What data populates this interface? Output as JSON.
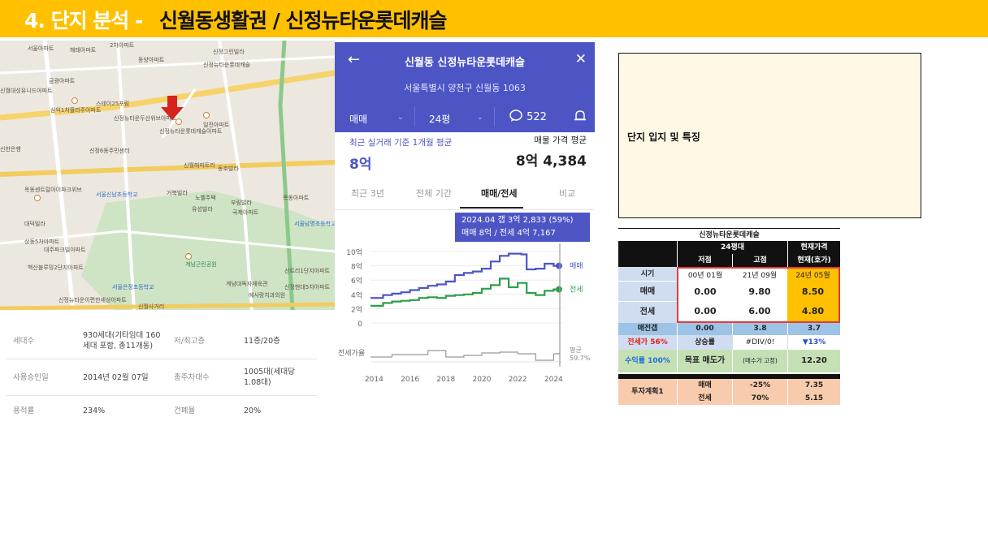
{
  "title": {
    "prefix": "4. 단지 분석 - ",
    "main": "신월동생활권 /  신정뉴타운롯데캐슬"
  },
  "map": {
    "labels": [
      "2차아파트",
      "서울아파트",
      "해태아파트",
      "동양아파트",
      "신정그린빌라",
      "신정뉴타운롯데캐슬",
      "금광아파트",
      "신월대성유니드아파트",
      "삼익1차플라주아파트",
      "스테이25포럼",
      "신정뉴타운두산위브아파트",
      "신정뉴타운롯데캐슬아파트",
      "일진아파트",
      "신정6동주민센터",
      "신월해피트리",
      "동호빌라",
      "신한은행",
      "목동센트럴아이파크위브",
      "서울신남초등학교",
      "거북빌라",
      "노벨주택",
      "유성빌라",
      "부림빌라",
      "국제아파트",
      "대덕빌라",
      "상동5차아파트",
      "대주파크빌아파트",
      "백산블루밍2단지아파트",
      "계남근린공원",
      "서울은정초등학교",
      "계남대독자체육관",
      "예사랑치과의원",
      "신정현대5차아파트",
      "선트리1단지아파트",
      "신월사거리",
      "신정뉴타운이편한세상아파트",
      "서울남명초등학교",
      "목동아파트"
    ]
  },
  "info_table": [
    {
      "k1": "세대수",
      "v1": "930세대(기타임대 160세대 포함, 총11개동)",
      "k2": "저/최고층",
      "v2": "11층/20층"
    },
    {
      "k1": "사용승인일",
      "v1": "2014년 02월 07일",
      "k2": "총주차대수",
      "v2": "1005대(세대당 1.08대)"
    },
    {
      "k1": "용적률",
      "v1": "234%",
      "k2": "건폐율",
      "v2": "20%"
    }
  ],
  "phone": {
    "back_icon": "←",
    "title": "신월동 신정뉴타운롯데캐슬",
    "close_icon": "✕",
    "address": "서울특별시 양천구 신월동 1063",
    "filter_type": "매매",
    "filter_size": "24평",
    "comment_count": "522",
    "basis_label": "최근 실거래 기준 1개월 평균",
    "recent_price": "8억",
    "avg_label": "매물 가격 평균",
    "avg_price": "8억 4,384",
    "tabs": [
      "최근 3년",
      "전체 기간",
      "매매/전세",
      "비교"
    ],
    "active_tab": "매매/전세",
    "tooltip_line1": "2024.04  갭 3억 2,833 (59%)",
    "tooltip_line2": "매매 8억 / 전세 4억 7,167"
  },
  "chart_data": {
    "type": "line",
    "x_ticks": [
      "2014",
      "2016",
      "2018",
      "2020",
      "2022",
      "2024"
    ],
    "y_ticks": [
      "10억",
      "8억",
      "6억",
      "4억",
      "2억",
      "0"
    ],
    "ylim": [
      0,
      10
    ],
    "series": [
      {
        "name": "매매",
        "color": "#4d55c5",
        "points": [
          [
            2013.8,
            3.5
          ],
          [
            2014.5,
            3.9
          ],
          [
            2015,
            4.1
          ],
          [
            2015.5,
            4.3
          ],
          [
            2016,
            4.6
          ],
          [
            2016.5,
            4.9
          ],
          [
            2017,
            5.2
          ],
          [
            2017.5,
            5.4
          ],
          [
            2018,
            5.8
          ],
          [
            2018.5,
            6.7
          ],
          [
            2019,
            7.0
          ],
          [
            2019.5,
            7.2
          ],
          [
            2020,
            7.6
          ],
          [
            2020.5,
            8.6
          ],
          [
            2021,
            9.4
          ],
          [
            2021.5,
            9.7
          ],
          [
            2022,
            9.7
          ],
          [
            2022.2,
            9.6
          ],
          [
            2022.5,
            7.5
          ],
          [
            2023,
            7.6
          ],
          [
            2023.5,
            8.3
          ],
          [
            2024,
            8.0
          ],
          [
            2024.3,
            8.0
          ]
        ]
      },
      {
        "name": "전세",
        "color": "#2e9d4a",
        "points": [
          [
            2013.8,
            2.4
          ],
          [
            2014.5,
            2.8
          ],
          [
            2015,
            3.0
          ],
          [
            2015.5,
            3.1
          ],
          [
            2016,
            3.2
          ],
          [
            2016.5,
            3.5
          ],
          [
            2017,
            3.6
          ],
          [
            2017.5,
            3.5
          ],
          [
            2018,
            3.8
          ],
          [
            2018.5,
            3.9
          ],
          [
            2019,
            4.0
          ],
          [
            2019.5,
            4.2
          ],
          [
            2020,
            4.8
          ],
          [
            2020.5,
            5.3
          ],
          [
            2021,
            6.2
          ],
          [
            2021.5,
            5.0
          ],
          [
            2022,
            5.6
          ],
          [
            2022.5,
            4.2
          ],
          [
            2023,
            3.9
          ],
          [
            2023.5,
            4.5
          ],
          [
            2024,
            4.7
          ],
          [
            2024.3,
            4.7
          ]
        ]
      },
      {
        "name": "전세가율",
        "color": "#999999",
        "points": [
          [
            2013.8,
            0.3
          ],
          [
            2015,
            0.45
          ],
          [
            2016,
            0.45
          ],
          [
            2017,
            0.7
          ],
          [
            2018,
            0.3
          ],
          [
            2019,
            0.4
          ],
          [
            2020,
            0.55
          ],
          [
            2021,
            0.6
          ],
          [
            2022,
            0.5
          ],
          [
            2023,
            0.1
          ],
          [
            2024,
            0.5
          ],
          [
            2024.3,
            0.55
          ]
        ]
      }
    ],
    "end_labels": {
      "sale": "매매",
      "jeonse": "전세",
      "ratio_label": "전세가율",
      "avg_label": "평균",
      "avg_value": "59.7%"
    }
  },
  "feature_box": {
    "label": "단지 입지 및 특징"
  },
  "sheet": {
    "title": "신정뉴타운롯데캐슬",
    "col_group": "24평대",
    "current_price": "현재가격",
    "h_low": "저점",
    "h_high": "고점",
    "h_now": "현재(호가)",
    "rows": [
      {
        "label": "시기",
        "low": "00년 01월",
        "high": "21년 09월",
        "now": "24년 05월"
      },
      {
        "label": "매매",
        "low": "0.00",
        "high": "9.80",
        "now": "8.50"
      },
      {
        "label": "전세",
        "low": "0.00",
        "high": "6.00",
        "now": "4.80"
      }
    ],
    "gap_label": "매전갭",
    "gap_low": "0.00",
    "gap_high": "3.8",
    "gap_now": "3.7",
    "jeonse_ratio_label": "전세가 56%",
    "rise_label": "상승률",
    "rise_value": "#DIV/0!",
    "rise_now": "▼13%",
    "yield_label": "수익률 100%",
    "target_label": "목표 매도가",
    "target_note": "(매수가 고정)",
    "target_value": "12.20",
    "plan_label": "투자계획1",
    "plan_sale_label": "매매",
    "plan_sale_pct": "-25%",
    "plan_sale_val": "7.35",
    "plan_jeonse_label": "전세",
    "plan_jeonse_pct": "70%",
    "plan_jeonse_val": "5.15"
  }
}
